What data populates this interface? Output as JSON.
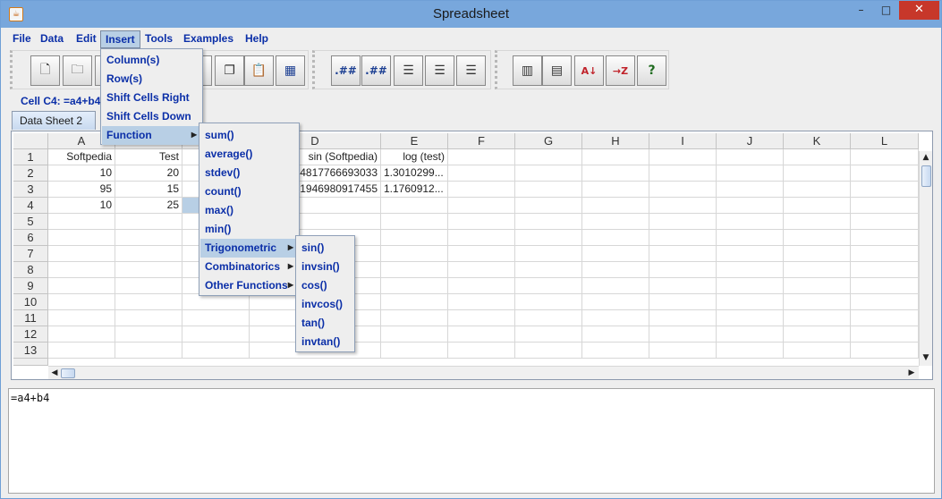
{
  "window": {
    "title": "Spreadsheet",
    "app_icon": "java-icon",
    "minimize": "–",
    "maximize": "□",
    "close": "✕"
  },
  "menubar": [
    "File",
    "Data",
    "Edit",
    "Insert",
    "Tools",
    "Examples",
    "Help"
  ],
  "toolbar": {
    "group1": [
      "new-document-icon",
      "open-folder-icon",
      "save-icon",
      "cut-icon",
      "copy-icon",
      "paste-icon",
      "sheet-grid-icon"
    ],
    "group2": [
      "decrease-decimal-icon",
      "increase-decimal-icon",
      "align-left-icon",
      "align-center-icon",
      "align-right-icon"
    ],
    "group3": [
      "insert-column-icon",
      "insert-row-icon",
      "sort-ascending-icon",
      "sort-descending-icon",
      "help-icon"
    ],
    "decimal_label": ".##"
  },
  "cell_reference": "Cell C4: =a4+b4",
  "sheet_tab": "Data Sheet 2",
  "grid": {
    "columns": [
      "A",
      "B",
      "C",
      "D",
      "E",
      "F",
      "G",
      "H",
      "I",
      "J",
      "K",
      "L"
    ],
    "rows": [
      "1",
      "2",
      "3",
      "4",
      "5",
      "6",
      "7",
      "8",
      "9",
      "10",
      "11",
      "12",
      "13"
    ],
    "cells": [
      [
        "Softpedia",
        "Test",
        "",
        "sin (Softpedia)",
        "log (test)"
      ],
      [
        "10",
        "20",
        "",
        "4817766693033",
        "1.3010299..."
      ],
      [
        "95",
        "15",
        "",
        "1946980917455",
        "1.1760912..."
      ],
      [
        "10",
        "25",
        "",
        "",
        ""
      ]
    ],
    "selected_cell": "C4"
  },
  "formula_text": "=a4+b4",
  "insert_menu": [
    "Column(s)",
    "Row(s)",
    "Shift Cells Right",
    "Shift Cells Down",
    "Function"
  ],
  "function_menu": [
    "sum()",
    "average()",
    "stdev()",
    "count()",
    "max()",
    "min()",
    "Trigonometric",
    "Combinatorics",
    "Other Functions"
  ],
  "trig_menu": [
    "sin()",
    "invsin()",
    "cos()",
    "invcos()",
    "tan()",
    "invtan()"
  ],
  "colors": {
    "titlebar": "#78a7dc",
    "menu_text": "#0b2fa8",
    "highlight": "#b8cfe5",
    "close_button": "#c7372a"
  }
}
